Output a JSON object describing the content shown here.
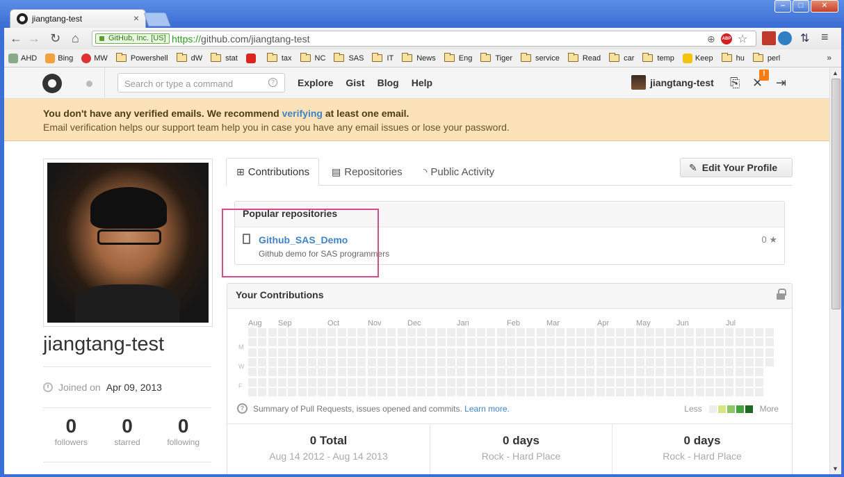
{
  "browser": {
    "tab_title": "jiangtang-test",
    "ev_label": "GitHub, Inc. [US]",
    "url_scheme": "https://",
    "url_rest": "github.com/jiangtang-test",
    "bookmarks": [
      "AHD",
      "Bing",
      "MW",
      "Powershell",
      "dW",
      "stat",
      "",
      "tax",
      "NC",
      "SAS",
      "IT",
      "News",
      "Eng",
      "Tiger",
      "service",
      "Read",
      "car",
      "temp",
      "Keep",
      "hu",
      "perl"
    ],
    "bookmarks_more": "»"
  },
  "header": {
    "search_placeholder": "Search or type a command",
    "nav": [
      "Explore",
      "Gist",
      "Blog",
      "Help"
    ],
    "username": "jiangtang-test",
    "badge": "!"
  },
  "flash": {
    "line1_pre": "You don't have any verified emails. We recommend ",
    "line1_link": "verifying",
    "line1_post": " at least one email.",
    "line2": "Email verification helps our support team help you in case you have any email issues or lose your password."
  },
  "profile": {
    "name": "jiangtang-test",
    "joined_label": "Joined on",
    "joined_date": "Apr 09, 2013",
    "stats": [
      {
        "num": "0",
        "label": "followers"
      },
      {
        "num": "0",
        "label": "starred"
      },
      {
        "num": "0",
        "label": "following"
      }
    ]
  },
  "tabs": {
    "contributions": "Contributions",
    "repositories": "Repositories",
    "activity": "Public Activity",
    "edit": "Edit Your Profile"
  },
  "popular": {
    "title": "Popular repositories",
    "repo_name": "Github_SAS_Demo",
    "repo_desc": "Github demo for SAS programmers",
    "stars": "0"
  },
  "contributions": {
    "title": "Your Contributions",
    "months": [
      "Aug",
      "Sep",
      "Oct",
      "Nov",
      "Dec",
      "Jan",
      "Feb",
      "Mar",
      "Apr",
      "May",
      "Jun",
      "Jul"
    ],
    "days": [
      "M",
      "W",
      "F"
    ],
    "summary_text": "Summary of Pull Requests, issues opened and commits.",
    "learn_more": "Learn more.",
    "legend_less": "Less",
    "legend_more": "More",
    "legend_colors": [
      "#eeeeee",
      "#d6e685",
      "#8cc665",
      "#44a340",
      "#1e6823"
    ],
    "totals": [
      {
        "big": "0 Total",
        "sub": "Aug 14 2012 - Aug 14 2013"
      },
      {
        "big": "0 days",
        "sub": "Rock - Hard Place"
      },
      {
        "big": "0 days",
        "sub": "Rock - Hard Place"
      }
    ]
  }
}
